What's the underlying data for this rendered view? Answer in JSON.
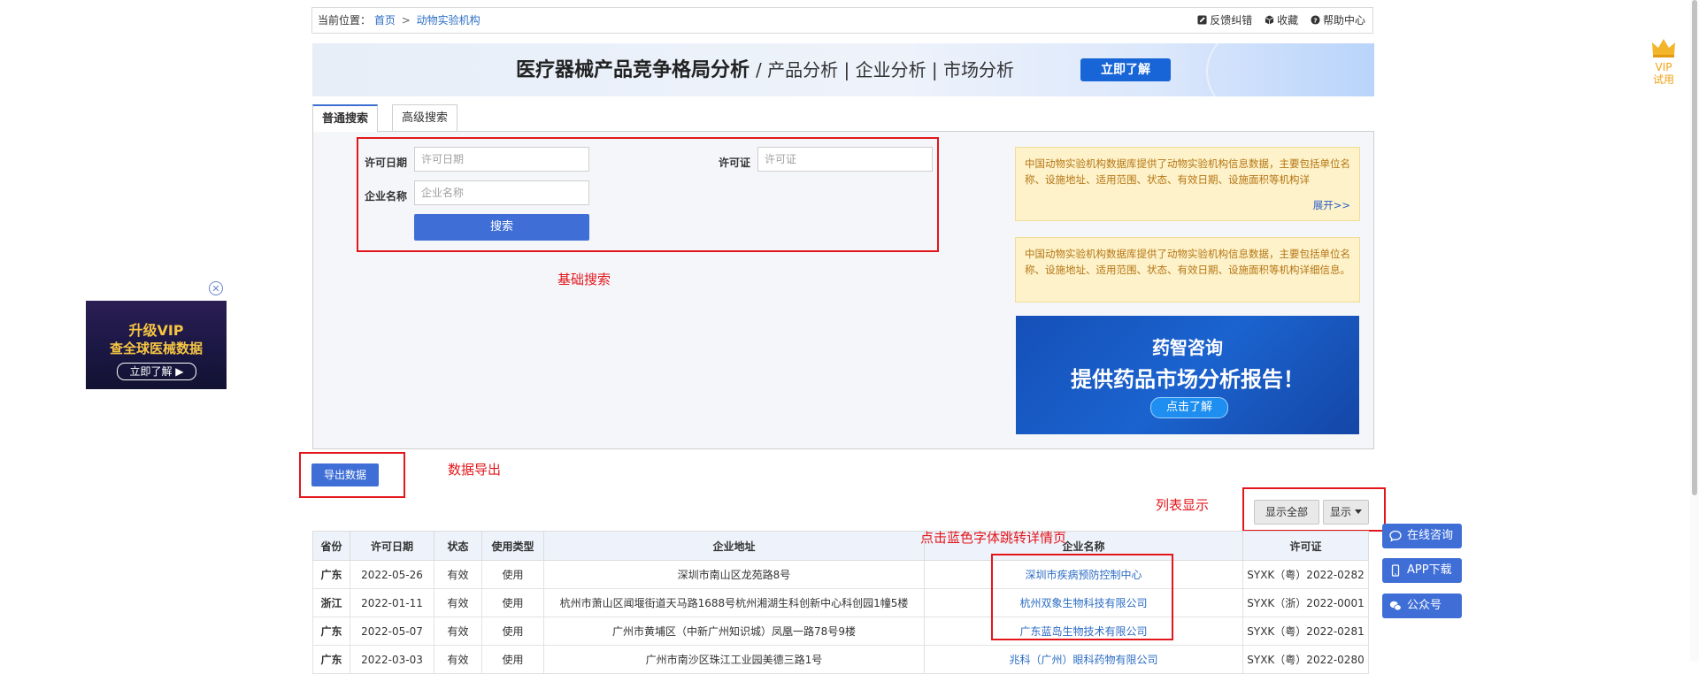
{
  "breadcrumb": {
    "prefix": "当前位置：",
    "home": "首页",
    "separator": ">",
    "current": "动物实验机构"
  },
  "toolbar": {
    "feedback": "反馈纠错",
    "favorite": "收藏",
    "help": "帮助中心"
  },
  "banner": {
    "title": "医疗器械产品竞争格局分析",
    "subtitle": "/ 产品分析 | 企业分析 | 市场分析",
    "button": "立即了解"
  },
  "tabs": [
    {
      "label": "普通搜索",
      "active": true
    },
    {
      "label": "高级搜索",
      "active": false
    }
  ],
  "search": {
    "date_label": "许可日期",
    "date_placeholder": "许可日期",
    "license_label": "许可证",
    "license_placeholder": "许可证",
    "company_label": "企业名称",
    "company_placeholder": "企业名称",
    "button": "搜索"
  },
  "annotations": {
    "basic_search": "基础搜索",
    "export": "数据导出",
    "list_display": "列表显示",
    "click_hint": "点击蓝色字体跳转详情页"
  },
  "notices": [
    {
      "text": "中国动物实验机构数据库提供了动物实验机构信息数据，主要包括单位名称、设施地址、适用范围、状态、有效日期、设施面积等机构详",
      "more": "展开>>"
    },
    {
      "text": "中国动物实验机构数据库提供了动物实验机构信息数据，主要包括单位名称、设施地址、适用范围、状态、有效日期、设施面积等机构详细信息。"
    }
  ],
  "side_ad": {
    "brand": "药智咨询",
    "headline": "提供药品市场分析报告！",
    "button": "点击了解"
  },
  "left_ad": {
    "line1": "升级VIP",
    "line2": "查全球医械数据",
    "button": "立即了解 ▶"
  },
  "export_button": "导出数据",
  "list_controls": {
    "show_all": "显示全部",
    "show": "显示"
  },
  "table": {
    "headers": [
      "省份",
      "许可日期",
      "状态",
      "使用类型",
      "企业地址",
      "企业名称",
      "许可证"
    ],
    "rows": [
      {
        "province": "广东",
        "date": "2022-05-26",
        "status": "有效",
        "type": "使用",
        "address": "深圳市南山区龙苑路8号",
        "company": "深圳市疾病预防控制中心",
        "license": "SYXK（粤）2022-0282"
      },
      {
        "province": "浙江",
        "date": "2022-01-11",
        "status": "有效",
        "type": "使用",
        "address": "杭州市萧山区闻堰街道天马路1688号杭州湘湖生科创新中心科创园1幢5楼",
        "company": "杭州双象生物科技有限公司",
        "license": "SYXK（浙）2022-0001"
      },
      {
        "province": "广东",
        "date": "2022-05-07",
        "status": "有效",
        "type": "使用",
        "address": "广州市黄埔区（中新广州知识城）凤凰一路78号9楼",
        "company": "广东蓝岛生物技术有限公司",
        "license": "SYXK（粤）2022-0281"
      },
      {
        "province": "广东",
        "date": "2022-03-03",
        "status": "有效",
        "type": "使用",
        "address": "广州市南沙区珠江工业园美德三路1号",
        "company": "兆科（广州）眼科药物有限公司",
        "license": "SYXK（粤）2022-0280"
      }
    ]
  },
  "right_float": {
    "consult": "在线咨询",
    "app": "APP下载",
    "wechat": "公众号"
  },
  "vip_badge": {
    "line1": "VIP",
    "line2": "试用"
  },
  "colors": {
    "primary": "#3f6fd6",
    "link": "#2b6cc4",
    "annotation_red": "#e3161b",
    "notice_bg": "#fdf2c9"
  }
}
